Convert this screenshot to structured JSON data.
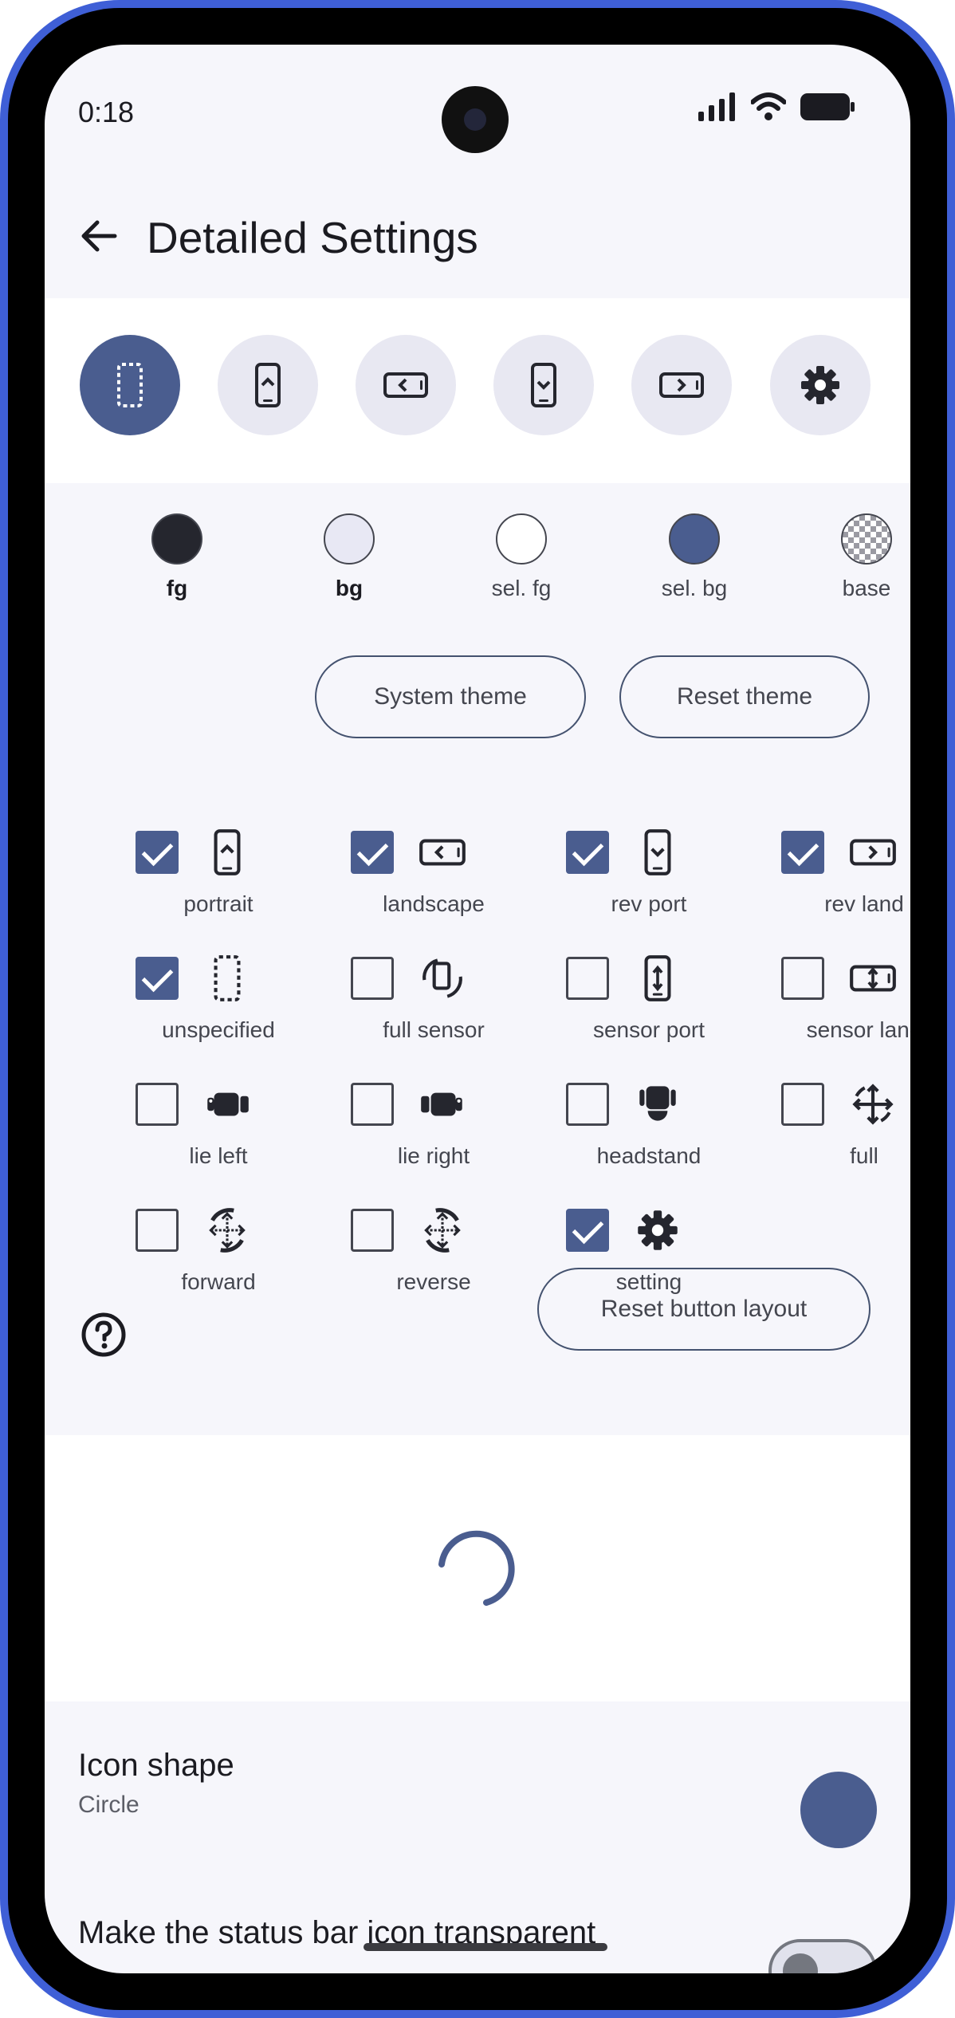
{
  "status_bar": {
    "time": "0:18"
  },
  "app_bar": {
    "title": "Detailed Settings"
  },
  "preview_buttons": [
    {
      "icon": "unspecified-icon",
      "selected": true
    },
    {
      "icon": "portrait-icon",
      "selected": false
    },
    {
      "icon": "landscape-icon",
      "selected": false
    },
    {
      "icon": "rev-port-icon",
      "selected": false
    },
    {
      "icon": "rev-land-icon",
      "selected": false
    },
    {
      "icon": "gear-icon",
      "selected": false
    }
  ],
  "colors": [
    {
      "label": "fg",
      "color": "#25262e"
    },
    {
      "label": "bg",
      "color": "#e8e8f4"
    },
    {
      "label": "sel. fg",
      "color": "#ffffff"
    },
    {
      "label": "sel. bg",
      "color": "#4a5d8f"
    },
    {
      "label": "base",
      "color": "checker"
    }
  ],
  "buttons": {
    "system_theme": "System theme",
    "reset_theme": "Reset theme",
    "reset_layout": "Reset button layout"
  },
  "options": [
    {
      "label": "portrait",
      "checked": true,
      "icon": "portrait-icon"
    },
    {
      "label": "landscape",
      "checked": true,
      "icon": "landscape-icon"
    },
    {
      "label": "rev port",
      "checked": true,
      "icon": "rev-port-icon"
    },
    {
      "label": "rev land",
      "checked": true,
      "icon": "rev-land-icon"
    },
    {
      "label": "unspecified",
      "checked": true,
      "icon": "unspecified-icon"
    },
    {
      "label": "full sensor",
      "checked": false,
      "icon": "full-sensor-icon"
    },
    {
      "label": "sensor port",
      "checked": false,
      "icon": "sensor-port-icon"
    },
    {
      "label": "sensor land",
      "checked": false,
      "icon": "sensor-land-icon"
    },
    {
      "label": "lie left",
      "checked": false,
      "icon": "lie-left-icon"
    },
    {
      "label": "lie right",
      "checked": false,
      "icon": "lie-right-icon"
    },
    {
      "label": "headstand",
      "checked": false,
      "icon": "headstand-icon"
    },
    {
      "label": "full",
      "checked": false,
      "icon": "full-icon"
    },
    {
      "label": "forward",
      "checked": false,
      "icon": "forward-icon"
    },
    {
      "label": "reverse",
      "checked": false,
      "icon": "reverse-icon"
    },
    {
      "label": "setting",
      "checked": true,
      "icon": "gear-icon"
    }
  ],
  "prefs": {
    "icon_shape_title": "Icon shape",
    "icon_shape_value": "Circle",
    "transparent_title": "Make the status bar icon transparent"
  }
}
